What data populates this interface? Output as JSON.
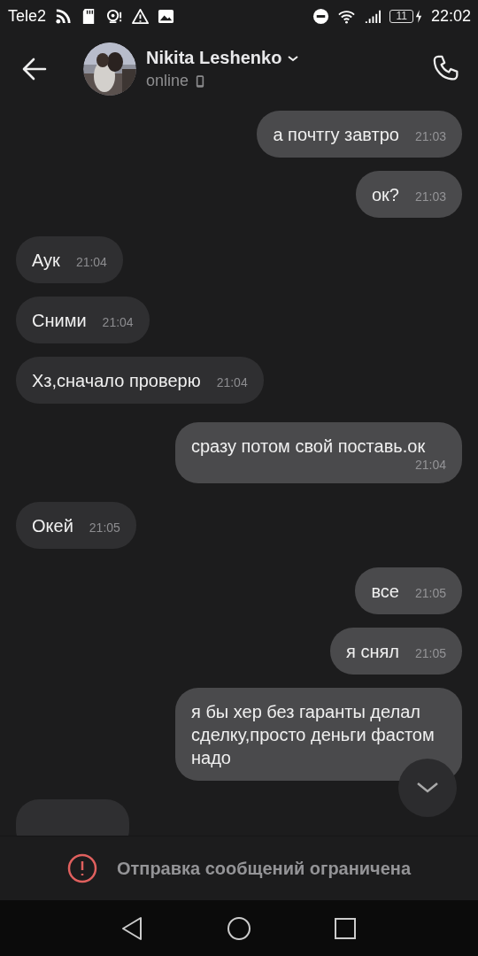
{
  "status_bar": {
    "carrier": "Tele2",
    "battery": "11",
    "time": "22:02"
  },
  "header": {
    "name": "Nikita Leshenko",
    "status": "online"
  },
  "messages": [
    {
      "kind": "outgoing",
      "text": "а почтгу завтро",
      "time": "21:03"
    },
    {
      "kind": "outgoing",
      "text": "ок?",
      "time": "21:03"
    },
    {
      "kind": "incoming",
      "text": "Аук",
      "time": "21:04"
    },
    {
      "kind": "incoming",
      "text": "Сними",
      "time": "21:04"
    },
    {
      "kind": "incoming",
      "text": "Хз,сначало проверю",
      "time": "21:04"
    },
    {
      "kind": "outgoing",
      "text": "сразу потом свой поставь.ок",
      "time": "21:04"
    },
    {
      "kind": "incoming",
      "text": "Окей",
      "time": "21:05"
    },
    {
      "kind": "outgoing",
      "text": "все",
      "time": "21:05"
    },
    {
      "kind": "outgoing",
      "text": "я снял",
      "time": "21:05"
    },
    {
      "kind": "outgoing",
      "text": "я бы хер без гаранты делал сделку,просто деньги фастом надо"
    },
    {
      "kind": "incoming"
    }
  ],
  "restriction_banner": {
    "text": "Отправка сообщений ограничена"
  }
}
